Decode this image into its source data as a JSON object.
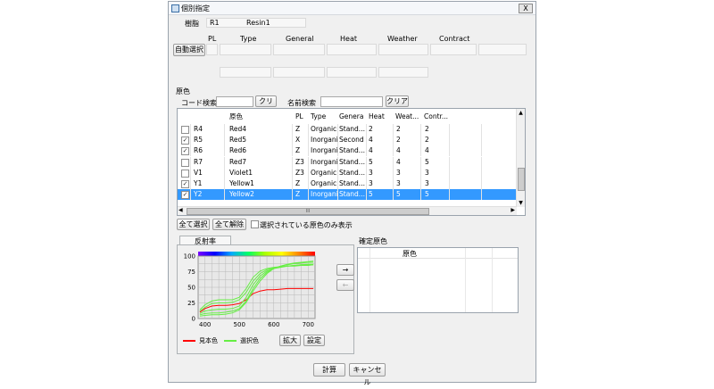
{
  "window": {
    "title": "個別指定",
    "close_label": "X"
  },
  "resin": {
    "label": "樹脂",
    "code": "R1",
    "name": "Resin1"
  },
  "props": {
    "headers": [
      "PL",
      "Type",
      "General",
      "Heat",
      "Weather",
      "Contract"
    ],
    "auto_select_label": "自動選択"
  },
  "colorant": {
    "section_label": "原色",
    "code_search_label": "コード検索",
    "code_value": "",
    "clear_label": "クリア",
    "name_search_label": "名前検索",
    "name_value": "",
    "clear2_label": "クリア"
  },
  "table": {
    "headers": [
      "原色",
      "PL",
      "Type",
      "General",
      "Heat",
      "Weat...",
      "Contr..."
    ],
    "rows": [
      {
        "checked": false,
        "code": "R4",
        "name": "Red4",
        "pl": "Z",
        "type": "Organic",
        "general": "Stand...",
        "heat": "2",
        "weather": "2",
        "contract": "2",
        "selected": false
      },
      {
        "checked": true,
        "code": "R5",
        "name": "Red5",
        "pl": "X",
        "type": "Inorgani",
        "general": "Second",
        "heat": "4",
        "weather": "2",
        "contract": "2",
        "selected": false
      },
      {
        "checked": true,
        "code": "R6",
        "name": "Red6",
        "pl": "Z",
        "type": "Inorgani",
        "general": "Stand...",
        "heat": "4",
        "weather": "4",
        "contract": "4",
        "selected": false
      },
      {
        "checked": false,
        "code": "R7",
        "name": "Red7",
        "pl": "Z3",
        "type": "Inorgani",
        "general": "Stand...",
        "heat": "5",
        "weather": "4",
        "contract": "5",
        "selected": false
      },
      {
        "checked": false,
        "code": "V1",
        "name": "Violet1",
        "pl": "Z3",
        "type": "Organic",
        "general": "Stand...",
        "heat": "3",
        "weather": "3",
        "contract": "3",
        "selected": false
      },
      {
        "checked": true,
        "code": "Y1",
        "name": "Yellow1",
        "pl": "Z",
        "type": "Organic",
        "general": "Stand...",
        "heat": "3",
        "weather": "3",
        "contract": "3",
        "selected": false
      },
      {
        "checked": true,
        "code": "Y2",
        "name": "Yellow2",
        "pl": "Z",
        "type": "Inorgani",
        "general": "Stand...",
        "heat": "5",
        "weather": "5",
        "contract": "5",
        "selected": true
      }
    ],
    "hscroll_label": "III"
  },
  "actions": {
    "select_all": "全て選択",
    "deselect_all": "全て解除",
    "show_selected_only": "選択されている原色のみ表示"
  },
  "tabs": {
    "reflectance": "反射率"
  },
  "chart_data": {
    "type": "line",
    "xlim": [
      380,
      720
    ],
    "ylim": [
      0,
      100
    ],
    "xticks": [
      400,
      500,
      600,
      700
    ],
    "yticks": [
      0,
      25,
      50,
      75,
      100
    ],
    "grid": true,
    "series": [
      {
        "name": "見本色",
        "color": "#ff0000",
        "x": [
          385,
          400,
          420,
          440,
          460,
          480,
          500,
          520,
          540,
          560,
          580,
          600,
          620,
          640,
          660,
          680,
          700,
          715
        ],
        "y": [
          10,
          16,
          20,
          21,
          21,
          22,
          24,
          30,
          40,
          44,
          46,
          46,
          47,
          48,
          48,
          48,
          48,
          48
        ]
      },
      {
        "name": "選択色",
        "color": "#66ee44",
        "x": [
          385,
          400,
          420,
          440,
          460,
          480,
          500,
          520,
          540,
          560,
          580,
          600,
          620,
          640,
          660,
          680,
          700,
          715
        ],
        "y": [
          14,
          22,
          28,
          30,
          30,
          30,
          34,
          48,
          66,
          76,
          80,
          82,
          83,
          84,
          84,
          85,
          85,
          86
        ]
      },
      {
        "name": "選択色",
        "color": "#66ee44",
        "x": [
          385,
          400,
          420,
          440,
          460,
          480,
          500,
          520,
          540,
          560,
          580,
          600,
          620,
          640,
          660,
          680,
          700,
          715
        ],
        "y": [
          8,
          12,
          14,
          15,
          15,
          16,
          20,
          34,
          54,
          68,
          76,
          80,
          82,
          84,
          85,
          86,
          87,
          87
        ]
      },
      {
        "name": "選択色",
        "color": "#66ee44",
        "x": [
          385,
          400,
          420,
          440,
          460,
          480,
          500,
          520,
          540,
          560,
          580,
          600,
          620,
          640,
          660,
          680,
          700,
          715
        ],
        "y": [
          6,
          8,
          9,
          9,
          10,
          12,
          16,
          28,
          48,
          64,
          74,
          80,
          84,
          86,
          88,
          89,
          90,
          90
        ]
      },
      {
        "name": "選択色",
        "color": "#66ee44",
        "x": [
          385,
          400,
          420,
          440,
          460,
          480,
          500,
          520,
          540,
          560,
          580,
          600,
          620,
          640,
          660,
          680,
          700,
          715
        ],
        "y": [
          4,
          5,
          6,
          6,
          7,
          9,
          14,
          26,
          44,
          60,
          72,
          80,
          84,
          87,
          89,
          90,
          91,
          92
        ]
      },
      {
        "name": "選択色",
        "color": "#66ee44",
        "x": [
          385,
          400,
          420,
          440,
          460,
          480,
          500,
          520,
          540,
          560,
          580,
          600,
          620,
          640,
          660,
          680,
          700,
          715
        ],
        "y": [
          12,
          18,
          24,
          25,
          25,
          26,
          30,
          42,
          60,
          72,
          78,
          81,
          83,
          84,
          85,
          86,
          86,
          86
        ]
      }
    ]
  },
  "legend": {
    "sample": "見本色",
    "selected": "選択色"
  },
  "chart_buttons": {
    "zoom": "拡大",
    "settings": "設定"
  },
  "arrows": {
    "right": "→",
    "left": "←"
  },
  "confirm": {
    "label": "確定原色",
    "header": "原色"
  },
  "footer": {
    "calc": "計算",
    "cancel": "キャンセル"
  },
  "colors": {
    "selection": "#3399ff",
    "sample": "#ff0000",
    "selected": "#66ee44"
  }
}
